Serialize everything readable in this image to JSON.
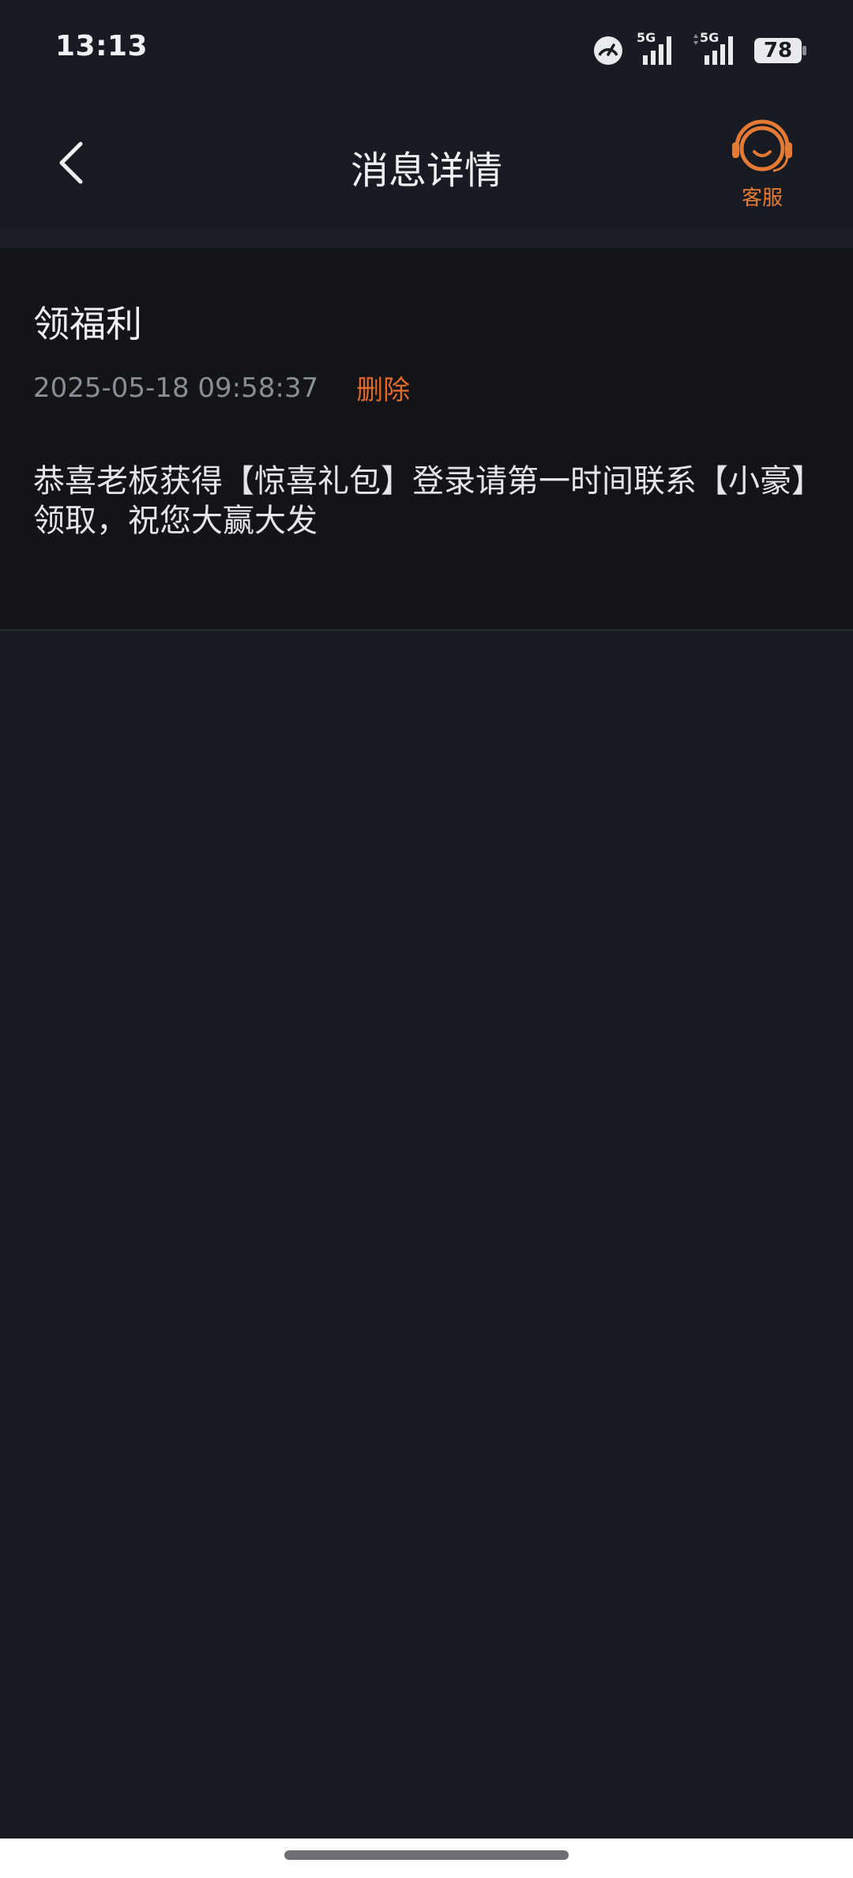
{
  "status_bar": {
    "time": "13:13",
    "network_1": "5G",
    "network_2": "5G",
    "battery": "78",
    "icons": [
      "speedometer-icon",
      "signal-icon",
      "signal-icon",
      "battery-icon"
    ]
  },
  "header": {
    "title": "消息详情",
    "back_icon": "chevron-left-icon",
    "service_icon": "headset-icon",
    "service_label": "客服"
  },
  "message": {
    "title": "领福利",
    "time": "2025-05-18 09:58:37",
    "delete_label": "删除",
    "body": "恭喜老板获得【惊喜礼包】登录请第一时间联系【小豪】领取，祝您大赢大发"
  },
  "colors": {
    "background": "#181b22",
    "card": "#131418",
    "accent": "#e06a2c",
    "muted_text": "#8a8d95"
  }
}
